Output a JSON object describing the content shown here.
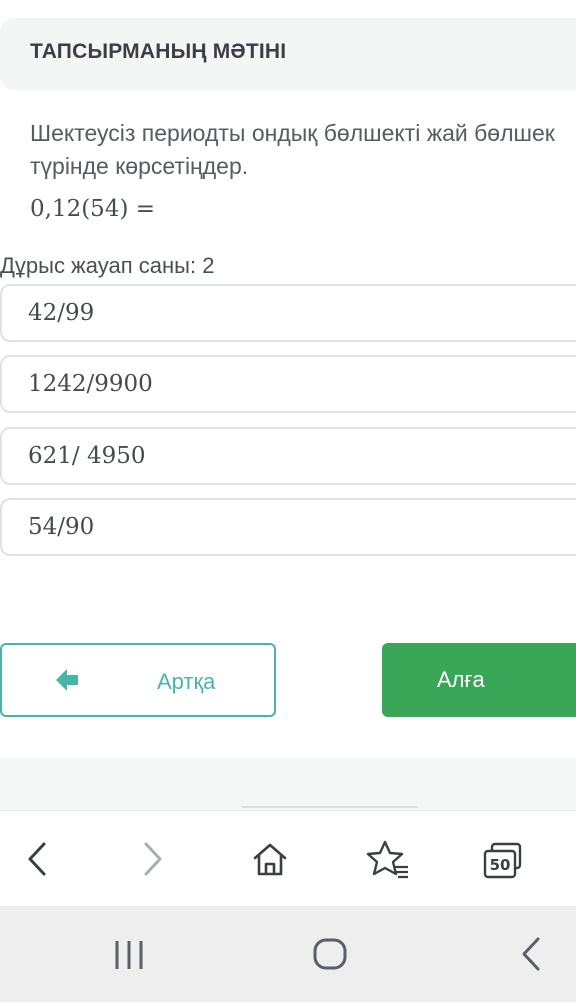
{
  "header": {
    "title": "ТАПСЫРМАНЫҢ МӘТІНІ"
  },
  "task": {
    "line1": "Шектеусіз периодты ондық бөлшекті жай бөлшек",
    "line2": "түрінде көрсетіңдер.",
    "formula": "0,12(54) ="
  },
  "answers": {
    "count_label": "Дұрыс жауап саны: 2",
    "options": [
      "42/99",
      "1242/9900",
      "621/ 4950",
      "54/90"
    ]
  },
  "buttons": {
    "back": "Артқа",
    "next": "Алға"
  },
  "browser_nav": {
    "icons": [
      "back-icon",
      "forward-icon",
      "home-icon",
      "bookmark-star-icon",
      "tabs-icon"
    ],
    "tabs_count": "50"
  },
  "system_nav": {
    "icons": [
      "recent-apps-icon",
      "home-circle-icon",
      "system-back-icon"
    ]
  },
  "colors": {
    "accent": "#4ab4ab",
    "primary": "#3aa657"
  }
}
